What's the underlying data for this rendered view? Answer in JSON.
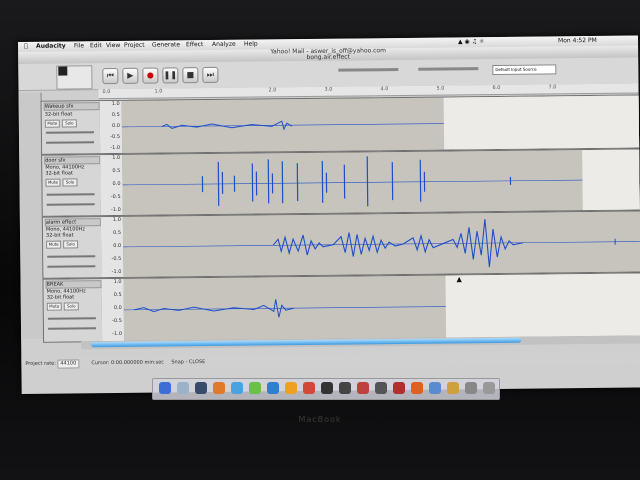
{
  "menubar": {
    "app": "Audacity",
    "items": [
      "File",
      "Edit",
      "View",
      "Project",
      "Generate",
      "Effect",
      "Analyze",
      "Help"
    ],
    "clock": "Mon 4:52 PM"
  },
  "window": {
    "title": "Yahoo! Mail - aswer_is_off@yahoo.com",
    "subtitle": "bong.air.effect"
  },
  "toolbar": {
    "input_source": "Default Input Source"
  },
  "ruler": {
    "ticks": [
      "0.0",
      "1.0",
      "2.0",
      "3.0",
      "4.0",
      "5.0",
      "6.0",
      "7.0"
    ]
  },
  "tracks": [
    {
      "name": "Wakeup sfx",
      "info1": "",
      "info2": "32-bit float",
      "mute": "Mute",
      "solo": "Solo",
      "scale": [
        "1.0",
        "0.5",
        "0.0",
        "-0.5",
        "-1.0"
      ]
    },
    {
      "name": "door sfx",
      "info1": "Mono, 44100Hz",
      "info2": "32-bit float",
      "mute": "Mute",
      "solo": "Solo",
      "scale": [
        "1.0",
        "0.5",
        "0.0",
        "-0.5",
        "-1.0"
      ]
    },
    {
      "name": "alarm effect",
      "info1": "Mono, 44100Hz",
      "info2": "32-bit float",
      "mute": "Mute",
      "solo": "Solo",
      "scale": [
        "1.0",
        "0.5",
        "0.0",
        "-0.5",
        "-1.0"
      ]
    },
    {
      "name": "BREAK",
      "info1": "Mono, 44100Hz",
      "info2": "32-bit float",
      "mute": "Mute",
      "solo": "Solo",
      "scale": [
        "1.0",
        "0.5",
        "0.0",
        "-0.5",
        "-1.0"
      ]
    }
  ],
  "status": {
    "project_rate_label": "Project rate:",
    "project_rate": "44100",
    "cursor": "Cursor: 0:00.000000 min:sec",
    "snap": "Snap - CLOSE"
  },
  "laptop": {
    "brand": "MacBook"
  },
  "colors": {
    "wave": "#1f4fc8",
    "bezel": "#0b0b0c"
  }
}
